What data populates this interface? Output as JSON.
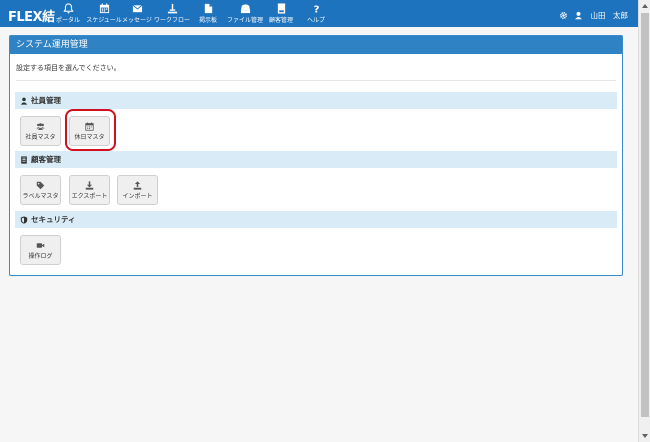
{
  "navbar": {
    "brand": "FLEX結",
    "items": [
      {
        "label": "ポータル",
        "icon": "bell-icon"
      },
      {
        "label": "スケジュール",
        "icon": "calendar-icon"
      },
      {
        "label": "メッセージ",
        "icon": "envelope-icon"
      },
      {
        "label": "ワークフロー",
        "icon": "workflow-icon"
      },
      {
        "label": "掲示板",
        "icon": "bulletin-icon"
      },
      {
        "label": "ファイル管理",
        "icon": "file-manager-icon"
      },
      {
        "label": "顧客管理",
        "icon": "customer-icon"
      },
      {
        "label": "ヘルプ",
        "icon": "help-icon"
      }
    ],
    "user_name": "山田　太郎"
  },
  "panel": {
    "title": "システム運用管理",
    "instruction": "設定する項目を選んでください。",
    "sections": [
      {
        "title": "社員管理",
        "icon": "user-icon",
        "tiles": [
          {
            "label": "社員マスタ",
            "icon": "users-icon"
          },
          {
            "label": "休日マスタ",
            "icon": "calendar-icon"
          }
        ]
      },
      {
        "title": "顧客管理",
        "icon": "address-book-icon",
        "tiles": [
          {
            "label": "ラベルマスタ",
            "icon": "tag-icon"
          },
          {
            "label": "エクスポート",
            "icon": "download-icon"
          },
          {
            "label": "インポート",
            "icon": "upload-icon"
          }
        ]
      },
      {
        "title": "セキュリティ",
        "icon": "shield-icon",
        "tiles": [
          {
            "label": "操作ログ",
            "icon": "video-camera-icon"
          }
        ]
      }
    ]
  },
  "colors": {
    "navbar": "#1e73be",
    "panel_heading": "#2f82c4",
    "section_bg": "#d9ebf6",
    "highlight": "#d0101e"
  }
}
